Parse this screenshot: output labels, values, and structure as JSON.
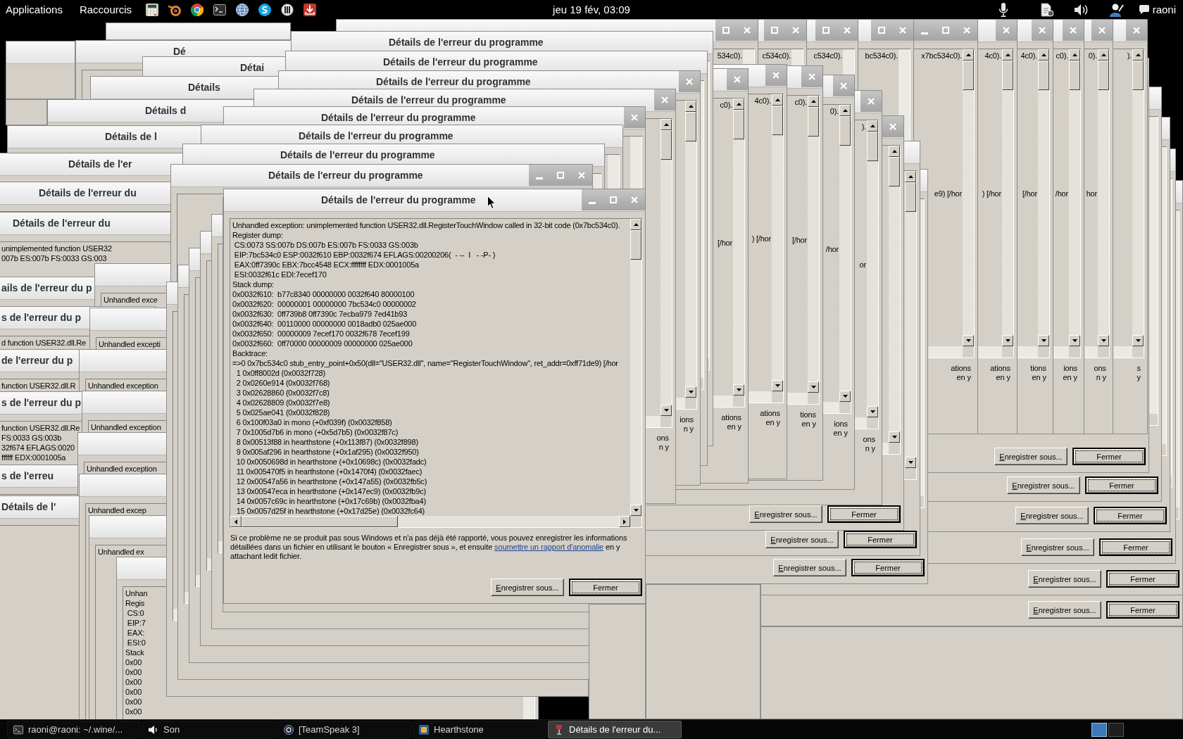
{
  "top_panel": {
    "menus": [
      "Applications",
      "Raccourcis"
    ],
    "clock": "jeu 19 fév, 03:09",
    "user": "raoni"
  },
  "left_windows": [
    {
      "kind": "error_dialog",
      "title": "Dé"
    },
    {
      "kind": "error_dialog",
      "title": "Détai"
    },
    {
      "kind": "error_dialog",
      "title": "Détails"
    },
    {
      "kind": "error_dialog",
      "title": "Détails d"
    },
    {
      "kind": "error_dialog",
      "title": "Détails de l"
    },
    {
      "kind": "error_dialog",
      "title": "Détails de l'er"
    },
    {
      "kind": "error_dialog",
      "title": "Détails de l'erreur du"
    },
    {
      "kind": "error_dialog",
      "title": "Détails de l'erreur du",
      "lines": [
        "unimplemented function USER32",
        "007b ES:007b FS:0033 GS:003"
      ]
    },
    {
      "kind": "error_dialog",
      "title": "ails de l'erreur du p"
    },
    {
      "kind": "error_dialog",
      "title": "s de l'erreur du p",
      "lines": [
        "d function USER32.dll.Re"
      ]
    },
    {
      "kind": "error_dialog",
      "title": "de l'erreur du p",
      "lines": [
        "function USER32.dll.R"
      ]
    },
    {
      "kind": "error_dialog",
      "title": "s de l'erreur du p",
      "lines": [
        "function USER32.dll.Re",
        "FS:0033 GS:003b",
        "32f674 EFLAGS:0020",
        "ffffff EDX:0001005a"
      ]
    },
    {
      "kind": "error_dialog",
      "title": "s de l'erreu"
    },
    {
      "kind": "error_dialog",
      "title": "Détails de l'"
    }
  ],
  "middle_windows": [
    {
      "kind": "error_dialog",
      "title": "Détails de l'erreur du programme"
    },
    {
      "kind": "error_dialog",
      "title": "Détails de l'erreur du programme"
    },
    {
      "kind": "error_dialog",
      "title": "Détails de l'erreur du programme",
      "info_end": [
        "ions",
        "n y"
      ]
    },
    {
      "kind": "error_dialog",
      "title": "Détails de l'erreur du programme",
      "info_end": [
        "ons",
        "n y"
      ]
    },
    {
      "kind": "error_dialog",
      "title": "Détails de l'erreur du programme"
    },
    {
      "kind": "error_dialog",
      "title": "Détails de l'erreur du programme"
    },
    {
      "kind": "error_dialog",
      "title": "Détails de l'erreur du programme"
    },
    {
      "kind": "error_dialog",
      "title": "Détails de l'erreur du programme"
    }
  ],
  "top_right_windows": [
    {
      "kind": "error_dialog",
      "first_line_end": "534c0)."
    },
    {
      "kind": "error_dialog",
      "first_line_end": "c534c0)."
    },
    {
      "kind": "error_dialog",
      "first_line_end": "c534c0)."
    },
    {
      "kind": "error_dialog",
      "first_line_end": "bc534c0)."
    },
    {
      "kind": "error_dialog",
      "first_line_end": "x7bc534c0).",
      "trace_end": "e9) [/hor",
      "info_end": [
        "ations",
        "en y"
      ]
    },
    {
      "kind": "error_dialog",
      "first_line_end": "4c0).",
      "trace_end": ") [/hor",
      "info_end": [
        "ations",
        "en y"
      ]
    },
    {
      "kind": "error_dialog",
      "first_line_end": "4c0).",
      "trace_end": "[/hor",
      "info_end": [
        "tions",
        "en y"
      ]
    },
    {
      "kind": "error_dialog",
      "first_line_end": "c0).",
      "trace_end": "/hor",
      "info_end": [
        "ions",
        "en y"
      ]
    },
    {
      "kind": "error_dialog",
      "first_line_end": "0).",
      "trace_end": "hor",
      "info_end": [
        "ons",
        "n y"
      ]
    },
    {
      "kind": "error_dialog",
      "first_line_end": ").",
      "info_end": [
        "s",
        "y"
      ]
    }
  ],
  "right_windows": [
    {
      "kind": "error_dialog",
      "first_line_end": "c0).",
      "trace_end": "[/hor",
      "info_end": [
        "ations",
        "en y"
      ]
    },
    {
      "kind": "error_dialog",
      "first_line_end": "4c0).",
      "trace_end": ") [/hor",
      "info_end": [
        "ations",
        "en y"
      ]
    },
    {
      "kind": "error_dialog",
      "first_line_end": "c0).",
      "trace_end": "[/hor",
      "info_end": [
        "tions",
        "en y"
      ]
    },
    {
      "kind": "error_dialog",
      "first_line_end": "0).",
      "trace_end": "/hor",
      "info_end": [
        "ions",
        "en y"
      ]
    },
    {
      "kind": "error_dialog",
      "first_line_end": ").",
      "trace_end": "or",
      "info_end": [
        "ons",
        "n y"
      ]
    }
  ],
  "lower_left_windows": [
    {
      "kind": "error_dialog",
      "lines": [
        "Unhandled exce"
      ]
    },
    {
      "kind": "error_dialog",
      "lines": [
        "Unhandled excepti"
      ]
    },
    {
      "kind": "error_dialog",
      "lines": [
        "Unhandled exception"
      ]
    },
    {
      "kind": "error_dialog",
      "lines": [
        "Unhandled exception"
      ]
    },
    {
      "kind": "error_dialog",
      "lines": [
        "Unhandled exception"
      ]
    },
    {
      "kind": "error_dialog",
      "lines": [
        "Unhandled excep"
      ]
    },
    {
      "kind": "error_dialog",
      "lines": [
        "Unhandled ex"
      ]
    },
    {
      "kind": "error_dialog",
      "lines": [
        "Unhan",
        "Regis",
        " CS:0",
        " EIP:7",
        " EAX:",
        " ESI:0",
        "Stack",
        "0x00",
        "0x00",
        "0x00",
        "0x00",
        "0x00",
        "0x00"
      ]
    }
  ],
  "lower_right_windows": [
    {
      "kind": "error_dialog",
      "buttons": [
        {
          "label": "Enregistrer sous...",
          "default": false
        },
        {
          "label": "Fermer",
          "default": true
        }
      ]
    },
    {
      "kind": "error_dialog",
      "buttons": [
        {
          "label": "Enregistrer sous...",
          "default": false
        },
        {
          "label": "Fermer",
          "default": true
        }
      ]
    },
    {
      "kind": "error_dialog",
      "buttons": [
        {
          "label": "Enregistrer sous...",
          "default": false
        },
        {
          "label": "Fermer",
          "default": true
        }
      ]
    }
  ],
  "far_right_windows": [
    {
      "kind": "error_dialog",
      "buttons": [
        {
          "label": "Enregistrer sous...",
          "default": false
        },
        {
          "label": "Fermer",
          "default": true
        }
      ]
    },
    {
      "kind": "error_dialog",
      "buttons": [
        {
          "label": "Enregistrer sous...",
          "default": false
        },
        {
          "label": "Fermer",
          "default": true
        }
      ]
    },
    {
      "kind": "error_dialog",
      "buttons": [
        {
          "label": "Enregistrer sous...",
          "default": false
        },
        {
          "label": "Fermer",
          "default": true
        }
      ]
    },
    {
      "kind": "error_dialog",
      "buttons": [
        {
          "label": "Enregistrer sous...",
          "default": false
        },
        {
          "label": "Fermer",
          "default": true
        }
      ]
    },
    {
      "kind": "error_dialog",
      "buttons": [
        {
          "label": "Enregistrer sous...",
          "default": false
        },
        {
          "label": "Fermer",
          "default": true
        }
      ]
    },
    {
      "kind": "error_dialog",
      "buttons": [
        {
          "label": "Enregistrer sous...",
          "default": false
        },
        {
          "label": "Fermer",
          "default": true
        }
      ]
    }
  ],
  "dialog": {
    "title": "Détails de l'erreur du programme",
    "report_lines": [
      "Unhandled exception: unimplemented function USER32.dll.RegisterTouchWindow called in 32-bit code (0x7bc534c0).",
      "Register dump:",
      " CS:0073 SS:007b DS:007b ES:007b FS:0033 GS:003b",
      " EIP:7bc534c0 ESP:0032f610 EBP:0032f674 EFLAGS:00200206(  - --  I   - -P- )",
      " EAX:0ff7390c EBX:7bcc4548 ECX:ffffffff EDX:0001005a",
      " ESI:0032f61c EDI:7ecef170",
      "Stack dump:",
      "0x0032f610:  b77c8340 00000000 0032f640 80000100",
      "0x0032f620:  00000001 00000000 7bc534c0 00000002",
      "0x0032f630:  0ff739b8 0ff7390c 7ecba979 7ed41b93",
      "0x0032f640:  00110000 00000000 0018adb0 025ae000",
      "0x0032f650:  00000009 7ecef170 0032f678 7ecef199",
      "0x0032f660:  0ff70000 00000009 00000000 025ae000",
      "Backtrace:",
      "=>0 0x7bc534c0 stub_entry_point+0x50(dll=\"USER32.dll\", name=\"RegisterTouchWindow\", ret_addr=0xff71de9) [/hor",
      "  1 0x0ff8002d (0x0032f728)",
      "  2 0x0260e914 (0x0032f768)",
      "  3 0x02628860 (0x0032f7c8)",
      "  4 0x02628809 (0x0032f7e8)",
      "  5 0x025ae041 (0x0032f828)",
      "  6 0x100f03a0 in mono (+0xf039f) (0x0032f858)",
      "  7 0x1005d7b6 in mono (+0x5d7b5) (0x0032f87c)",
      "  8 0x00513f88 in hearthstone (+0x113f87) (0x0032f898)",
      "  9 0x005af296 in hearthstone (+0x1af295) (0x0032f950)",
      "  10 0x0050698d in hearthstone (+0x10698c) (0x0032fadc)",
      "  11 0x005470f5 in hearthstone (+0x1470f4) (0x0032faec)",
      "  12 0x00547a56 in hearthstone (+0x147a55) (0x0032fb5c)",
      "  13 0x00547eca in hearthstone (+0x147ec9) (0x0032fb9c)",
      "  14 0x0057c69c in hearthstone (+0x17c69b) (0x0032fba4)",
      "  15 0x0057d25f in hearthstone (+0x17d25e) (0x0032fc64)"
    ],
    "info": {
      "before": "Si ce problème ne se produit pas sous Windows et n'a pas déjà été rapporté, vous pouvez enregistrer les informations détaillées dans un fichier en utilisant le bouton « Enregistrer sous », et ensuite",
      "link": "soumettre un rapport d'anomalie",
      "after": "en y attachant ledit fichier."
    },
    "buttons": [
      {
        "label": "Enregistrer sous...",
        "default": false
      },
      {
        "label": "Fermer",
        "default": true
      }
    ]
  },
  "taskbar": {
    "items": [
      {
        "label": "raoni@raoni: ~/.wine/...",
        "selected": false
      },
      {
        "label": "Son",
        "selected": false
      },
      {
        "label": "[TeamSpeak 3]",
        "selected": false
      },
      {
        "label": "Hearthstone",
        "selected": false
      },
      {
        "label": "Détails de l'erreur du...",
        "selected": true
      }
    ],
    "workspaces": [
      {
        "selected": true
      },
      {
        "selected": false
      }
    ]
  }
}
